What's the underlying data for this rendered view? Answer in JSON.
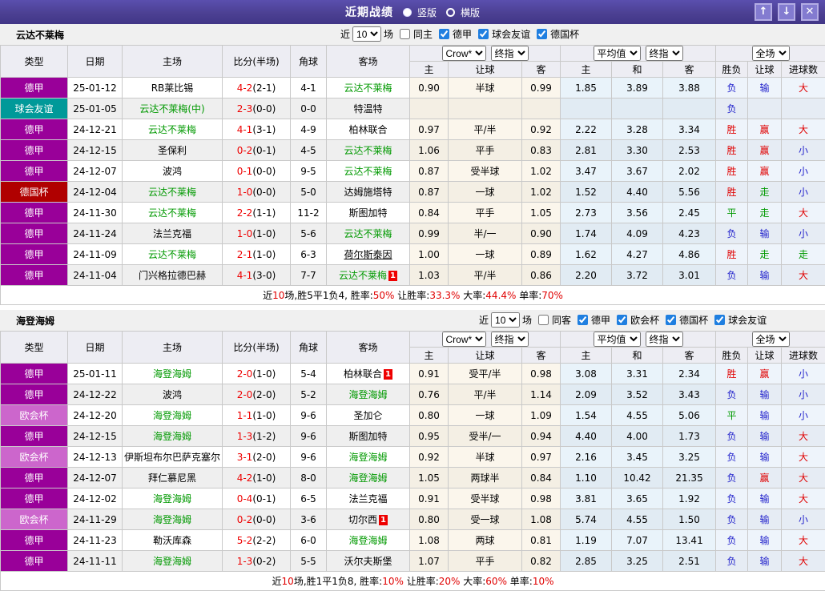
{
  "title_bar": {
    "title": "近期战绩",
    "radio_vertical": "竖版",
    "radio_horizontal": "横版",
    "up_glyph": "↑",
    "down_glyph": "↓",
    "close_glyph": "✕"
  },
  "columns": {
    "left": [
      "类型",
      "日期",
      "主场",
      "比分(半场)",
      "角球",
      "客场"
    ],
    "sub": [
      "主",
      "让球",
      "客",
      "主",
      "和",
      "客",
      "胜负",
      "让球",
      "进球数"
    ]
  },
  "league_colors": {
    "德甲": "#990099",
    "球会友谊": "#009999",
    "德国杯": "#B00000",
    "欧会杯": "#CC66CC"
  },
  "result_colors": {
    "胜": "#E00000",
    "赢": "#E00000",
    "大": "#E00000",
    "负": "#2222CC",
    "输": "#2222CC",
    "小": "#2222CC",
    "平": "#009900",
    "走": "#009900"
  },
  "sections": [
    {
      "team": "云达不莱梅",
      "filter": {
        "near": "近",
        "count": "10",
        "games": "场",
        "same": "同主",
        "same_checked": false,
        "leagues": [
          "德甲",
          "球会友谊",
          "德国杯"
        ]
      },
      "selects": {
        "company": "Crow*",
        "final1": "终指",
        "avg": "平均值",
        "final2": "终指",
        "scope": "全场"
      },
      "rows": [
        {
          "league": "德甲",
          "date": "25-01-12",
          "home": "RB莱比锡",
          "hf": false,
          "hb": "",
          "score": "4-2",
          "half": "(2-1)",
          "corner": "4-1",
          "away": "云达不莱梅",
          "af": true,
          "ab": "",
          "al": false,
          "ah": [
            "0.90",
            "半球",
            "0.99"
          ],
          "eu": [
            "1.85",
            "3.89",
            "3.88"
          ],
          "res": [
            "负",
            "输",
            "大"
          ]
        },
        {
          "league": "球会友谊",
          "date": "25-01-05",
          "home": "云达不莱梅(中)",
          "hf": true,
          "hb": "",
          "score": "2-3",
          "half": "(0-0)",
          "corner": "0-0",
          "away": "特温特",
          "af": false,
          "ab": "",
          "al": false,
          "ah": [
            "",
            "",
            ""
          ],
          "eu": [
            "",
            "",
            ""
          ],
          "res": [
            "负",
            "",
            ""
          ]
        },
        {
          "league": "德甲",
          "date": "24-12-21",
          "home": "云达不莱梅",
          "hf": true,
          "hb": "",
          "score": "4-1",
          "half": "(3-1)",
          "corner": "4-9",
          "away": "柏林联合",
          "af": false,
          "ab": "",
          "al": false,
          "ah": [
            "0.97",
            "平/半",
            "0.92"
          ],
          "eu": [
            "2.22",
            "3.28",
            "3.34"
          ],
          "res": [
            "胜",
            "赢",
            "大"
          ]
        },
        {
          "league": "德甲",
          "date": "24-12-15",
          "home": "圣保利",
          "hf": false,
          "hb": "",
          "score": "0-2",
          "half": "(0-1)",
          "corner": "4-5",
          "away": "云达不莱梅",
          "af": true,
          "ab": "",
          "al": false,
          "ah": [
            "1.06",
            "平手",
            "0.83"
          ],
          "eu": [
            "2.81",
            "3.30",
            "2.53"
          ],
          "res": [
            "胜",
            "赢",
            "小"
          ]
        },
        {
          "league": "德甲",
          "date": "24-12-07",
          "home": "波鸿",
          "hf": false,
          "hb": "",
          "score": "0-1",
          "half": "(0-0)",
          "corner": "9-5",
          "away": "云达不莱梅",
          "af": true,
          "ab": "",
          "al": false,
          "ah": [
            "0.87",
            "受半球",
            "1.02"
          ],
          "eu": [
            "3.47",
            "3.67",
            "2.02"
          ],
          "res": [
            "胜",
            "赢",
            "小"
          ]
        },
        {
          "league": "德国杯",
          "date": "24-12-04",
          "home": "云达不莱梅",
          "hf": true,
          "hb": "",
          "score": "1-0",
          "half": "(0-0)",
          "corner": "5-0",
          "away": "达姆施塔特",
          "af": false,
          "ab": "",
          "al": false,
          "ah": [
            "0.87",
            "一球",
            "1.02"
          ],
          "eu": [
            "1.52",
            "4.40",
            "5.56"
          ],
          "res": [
            "胜",
            "走",
            "小"
          ]
        },
        {
          "league": "德甲",
          "date": "24-11-30",
          "home": "云达不莱梅",
          "hf": true,
          "hb": "",
          "score": "2-2",
          "half": "(1-1)",
          "corner": "11-2",
          "away": "斯图加特",
          "af": false,
          "ab": "",
          "al": false,
          "ah": [
            "0.84",
            "平手",
            "1.05"
          ],
          "eu": [
            "2.73",
            "3.56",
            "2.45"
          ],
          "res": [
            "平",
            "走",
            "大"
          ]
        },
        {
          "league": "德甲",
          "date": "24-11-24",
          "home": "法兰克福",
          "hf": false,
          "hb": "",
          "score": "1-0",
          "half": "(1-0)",
          "corner": "5-6",
          "away": "云达不莱梅",
          "af": true,
          "ab": "",
          "al": false,
          "ah": [
            "0.99",
            "半/一",
            "0.90"
          ],
          "eu": [
            "1.74",
            "4.09",
            "4.23"
          ],
          "res": [
            "负",
            "输",
            "小"
          ]
        },
        {
          "league": "德甲",
          "date": "24-11-09",
          "home": "云达不莱梅",
          "hf": true,
          "hb": "",
          "score": "2-1",
          "half": "(1-0)",
          "corner": "6-3",
          "away": "荷尔斯泰因",
          "af": false,
          "ab": "",
          "al": true,
          "ah": [
            "1.00",
            "一球",
            "0.89"
          ],
          "eu": [
            "1.62",
            "4.27",
            "4.86"
          ],
          "res": [
            "胜",
            "走",
            "走"
          ]
        },
        {
          "league": "德甲",
          "date": "24-11-04",
          "home": "门兴格拉德巴赫",
          "hf": false,
          "hb": "",
          "score": "4-1",
          "half": "(3-0)",
          "corner": "7-7",
          "away": "云达不莱梅",
          "af": true,
          "ab": "1",
          "al": false,
          "ah": [
            "1.03",
            "平/半",
            "0.86"
          ],
          "eu": [
            "2.20",
            "3.72",
            "3.01"
          ],
          "res": [
            "负",
            "输",
            "大"
          ]
        }
      ],
      "summary": [
        [
          "近",
          "k"
        ],
        [
          "10",
          "r"
        ],
        [
          "场,胜5平1负4, 胜率:",
          "k"
        ],
        [
          "50%",
          "r"
        ],
        [
          " 让胜率:",
          "k"
        ],
        [
          "33.3%",
          "r"
        ],
        [
          " 大率:",
          "k"
        ],
        [
          "44.4%",
          "r"
        ],
        [
          " 单率:",
          "k"
        ],
        [
          "70%",
          "r"
        ]
      ]
    },
    {
      "team": "海登海姆",
      "filter": {
        "near": "近",
        "count": "10",
        "games": "场",
        "same": "同客",
        "same_checked": false,
        "leagues": [
          "德甲",
          "欧会杯",
          "德国杯",
          "球会友谊"
        ]
      },
      "selects": {
        "company": "Crow*",
        "final1": "终指",
        "avg": "平均值",
        "final2": "终指",
        "scope": "全场"
      },
      "rows": [
        {
          "league": "德甲",
          "date": "25-01-11",
          "home": "海登海姆",
          "hf": true,
          "hb": "",
          "score": "2-0",
          "half": "(1-0)",
          "corner": "5-4",
          "away": "柏林联合",
          "af": false,
          "ab": "1",
          "al": false,
          "ah": [
            "0.91",
            "受平/半",
            "0.98"
          ],
          "eu": [
            "3.08",
            "3.31",
            "2.34"
          ],
          "res": [
            "胜",
            "赢",
            "小"
          ]
        },
        {
          "league": "德甲",
          "date": "24-12-22",
          "home": "波鸿",
          "hf": false,
          "hb": "",
          "score": "2-0",
          "half": "(2-0)",
          "corner": "5-2",
          "away": "海登海姆",
          "af": true,
          "ab": "",
          "al": false,
          "ah": [
            "0.76",
            "平/半",
            "1.14"
          ],
          "eu": [
            "2.09",
            "3.52",
            "3.43"
          ],
          "res": [
            "负",
            "输",
            "小"
          ]
        },
        {
          "league": "欧会杯",
          "date": "24-12-20",
          "home": "海登海姆",
          "hf": true,
          "hb": "",
          "score": "1-1",
          "half": "(1-0)",
          "corner": "9-6",
          "away": "圣加仑",
          "af": false,
          "ab": "",
          "al": false,
          "ah": [
            "0.80",
            "一球",
            "1.09"
          ],
          "eu": [
            "1.54",
            "4.55",
            "5.06"
          ],
          "res": [
            "平",
            "输",
            "小"
          ]
        },
        {
          "league": "德甲",
          "date": "24-12-15",
          "home": "海登海姆",
          "hf": true,
          "hb": "",
          "score": "1-3",
          "half": "(1-2)",
          "corner": "9-6",
          "away": "斯图加特",
          "af": false,
          "ab": "",
          "al": false,
          "ah": [
            "0.95",
            "受半/一",
            "0.94"
          ],
          "eu": [
            "4.40",
            "4.00",
            "1.73"
          ],
          "res": [
            "负",
            "输",
            "大"
          ]
        },
        {
          "league": "欧会杯",
          "date": "24-12-13",
          "home": "伊斯坦布尔巴萨克塞尔",
          "hf": false,
          "hb": "",
          "score": "3-1",
          "half": "(2-0)",
          "corner": "9-6",
          "away": "海登海姆",
          "af": true,
          "ab": "",
          "al": false,
          "ah": [
            "0.92",
            "半球",
            "0.97"
          ],
          "eu": [
            "2.16",
            "3.45",
            "3.25"
          ],
          "res": [
            "负",
            "输",
            "大"
          ]
        },
        {
          "league": "德甲",
          "date": "24-12-07",
          "home": "拜仁慕尼黑",
          "hf": false,
          "hb": "",
          "score": "4-2",
          "half": "(1-0)",
          "corner": "8-0",
          "away": "海登海姆",
          "af": true,
          "ab": "",
          "al": false,
          "ah": [
            "1.05",
            "两球半",
            "0.84"
          ],
          "eu": [
            "1.10",
            "10.42",
            "21.35"
          ],
          "res": [
            "负",
            "赢",
            "大"
          ]
        },
        {
          "league": "德甲",
          "date": "24-12-02",
          "home": "海登海姆",
          "hf": true,
          "hb": "",
          "score": "0-4",
          "half": "(0-1)",
          "corner": "6-5",
          "away": "法兰克福",
          "af": false,
          "ab": "",
          "al": false,
          "ah": [
            "0.91",
            "受半球",
            "0.98"
          ],
          "eu": [
            "3.81",
            "3.65",
            "1.92"
          ],
          "res": [
            "负",
            "输",
            "大"
          ]
        },
        {
          "league": "欧会杯",
          "date": "24-11-29",
          "home": "海登海姆",
          "hf": true,
          "hb": "",
          "score": "0-2",
          "half": "(0-0)",
          "corner": "3-6",
          "away": "切尔西",
          "af": false,
          "ab": "1",
          "al": false,
          "ah": [
            "0.80",
            "受一球",
            "1.08"
          ],
          "eu": [
            "5.74",
            "4.55",
            "1.50"
          ],
          "res": [
            "负",
            "输",
            "小"
          ]
        },
        {
          "league": "德甲",
          "date": "24-11-23",
          "home": "勒沃库森",
          "hf": false,
          "hb": "",
          "score": "5-2",
          "half": "(2-2)",
          "corner": "6-0",
          "away": "海登海姆",
          "af": true,
          "ab": "",
          "al": false,
          "ah": [
            "1.08",
            "两球",
            "0.81"
          ],
          "eu": [
            "1.19",
            "7.07",
            "13.41"
          ],
          "res": [
            "负",
            "输",
            "大"
          ]
        },
        {
          "league": "德甲",
          "date": "24-11-11",
          "home": "海登海姆",
          "hf": true,
          "hb": "",
          "score": "1-3",
          "half": "(0-2)",
          "corner": "5-5",
          "away": "沃尔夫斯堡",
          "af": false,
          "ab": "",
          "al": false,
          "ah": [
            "1.07",
            "平手",
            "0.82"
          ],
          "eu": [
            "2.85",
            "3.25",
            "2.51"
          ],
          "res": [
            "负",
            "输",
            "大"
          ]
        }
      ],
      "summary": [
        [
          "近",
          "k"
        ],
        [
          "10",
          "r"
        ],
        [
          "场,胜1平1负8, 胜率:",
          "k"
        ],
        [
          "10%",
          "r"
        ],
        [
          " 让胜率:",
          "k"
        ],
        [
          "20%",
          "r"
        ],
        [
          " 大率:",
          "k"
        ],
        [
          "60%",
          "r"
        ],
        [
          " 单率:",
          "k"
        ],
        [
          "10%",
          "r"
        ]
      ]
    }
  ]
}
